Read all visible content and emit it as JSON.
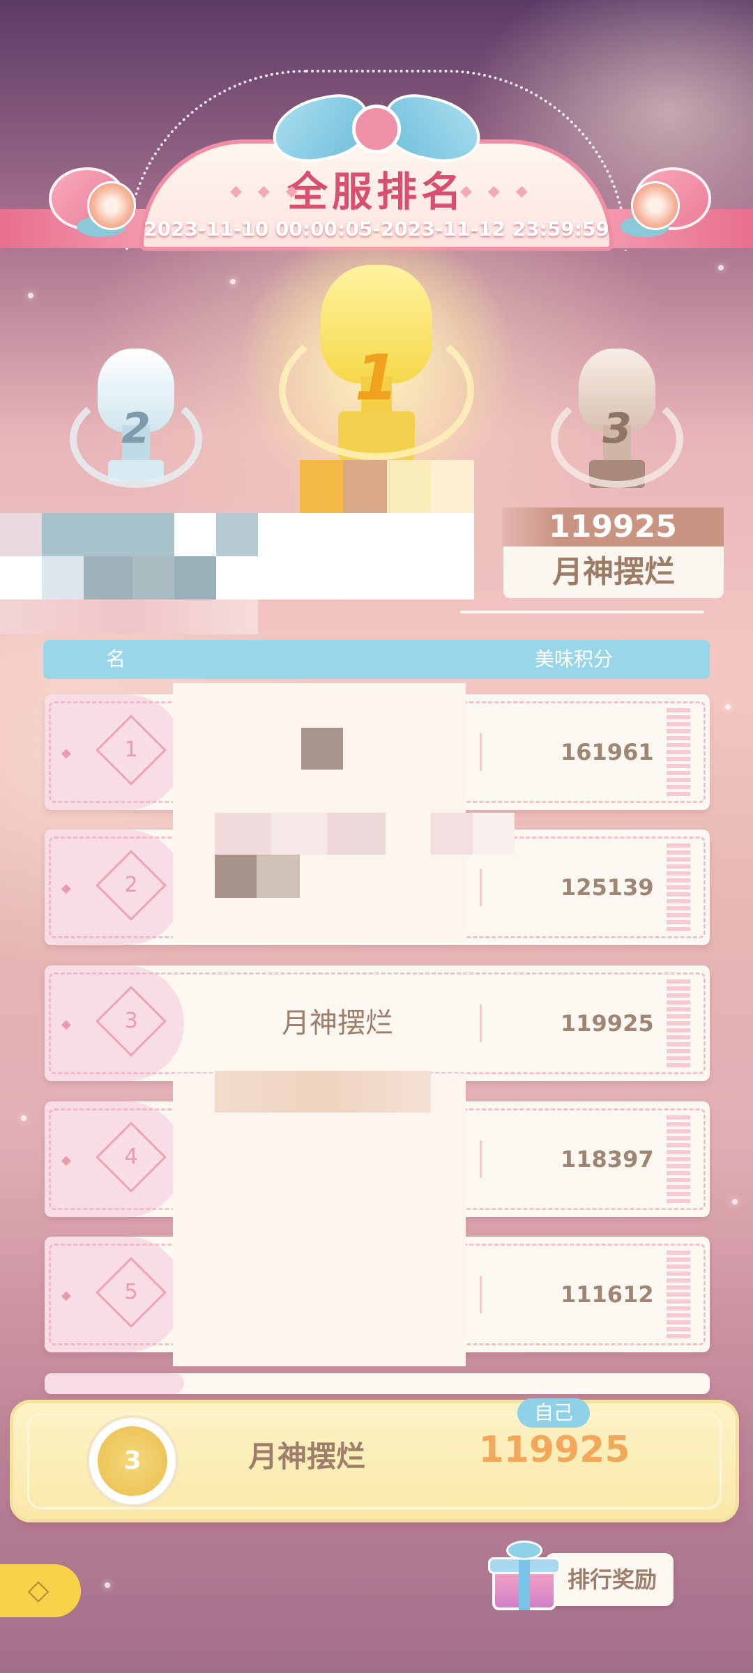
{
  "header": {
    "title": "全服排名",
    "period": "2023-11-10 00:00:05-2023-11-12 23:59:59",
    "diamonds_left": "◆ ◆ ◆",
    "diamonds_right": "◆ ◆ ◆"
  },
  "podium": {
    "first": {
      "rank": "1",
      "color": "#f6d84a"
    },
    "second": {
      "rank": "2",
      "color": "#cfe6ef"
    },
    "third": {
      "rank": "3",
      "color": "#d8c0b0",
      "score": "119925",
      "name": "月神摆烂"
    }
  },
  "columns": {
    "rank": "名",
    "score": "美味积分"
  },
  "ranking": [
    {
      "rank": "1",
      "name": "",
      "score": "161961"
    },
    {
      "rank": "2",
      "name": "",
      "score": "125139"
    },
    {
      "rank": "3",
      "name": "月神摆烂",
      "score": "119925"
    },
    {
      "rank": "4",
      "name": "",
      "score": "118397"
    },
    {
      "rank": "5",
      "name": "",
      "score": "111612"
    }
  ],
  "self": {
    "tag": "自己",
    "rank": "3",
    "name": "月神摆烂",
    "score": "119925"
  },
  "bottom": {
    "back_icon": "back-arrow-icon",
    "back_glyph": "◇",
    "reward_label": "排行奖励",
    "reward_icon": "gift-box-icon"
  },
  "colors": {
    "accent_pink": "#e86f8e",
    "header_blue": "#9ad6e9",
    "self_score": "#f2a75a"
  }
}
